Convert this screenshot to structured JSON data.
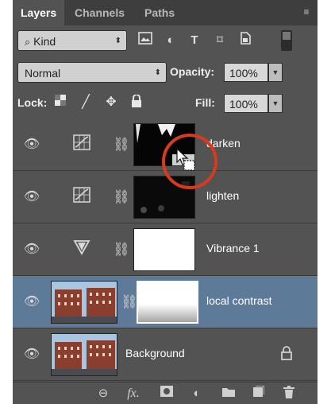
{
  "tabs": {
    "layers": "Layers",
    "channels": "Channels",
    "paths": "Paths"
  },
  "filter": {
    "kind_label": "Kind",
    "icons": [
      "image-filter-icon",
      "adjustment-filter-icon",
      "type-filter-icon",
      "shape-filter-icon",
      "smart-object-filter-icon"
    ]
  },
  "blend": {
    "mode": "Normal",
    "opacity_label": "Opacity:",
    "opacity_value": "100%"
  },
  "lock": {
    "label": "Lock:",
    "icons": [
      "lock-transparent-icon",
      "lock-image-icon",
      "lock-position-icon",
      "lock-all-icon"
    ],
    "fill_label": "Fill:",
    "fill_value": "100%"
  },
  "layers": [
    {
      "name": "darken",
      "kind": "adjustment",
      "adjustment_icon": "curves-icon",
      "mask": "dark-mask",
      "selected": false
    },
    {
      "name": "lighten",
      "kind": "adjustment",
      "adjustment_icon": "curves-icon",
      "mask": "dark-mask",
      "selected": false
    },
    {
      "name": "Vibrance 1",
      "kind": "adjustment",
      "adjustment_icon": "vibrance-icon",
      "mask": "white-mask",
      "selected": false
    },
    {
      "name": "local contrast",
      "kind": "pixel-with-mask",
      "mask": "gradient-mask",
      "selected": true
    },
    {
      "name": "Background",
      "kind": "background",
      "locked": true,
      "selected": false
    }
  ],
  "footer_icons": [
    "link-layers-icon",
    "fx-icon",
    "add-mask-icon",
    "adjustment-layer-icon",
    "group-folder-icon",
    "new-layer-icon",
    "trash-icon"
  ],
  "colors": {
    "panel": "#535353",
    "selected_row": "#5e7a99",
    "annotation_circle": "#d63a1f"
  }
}
